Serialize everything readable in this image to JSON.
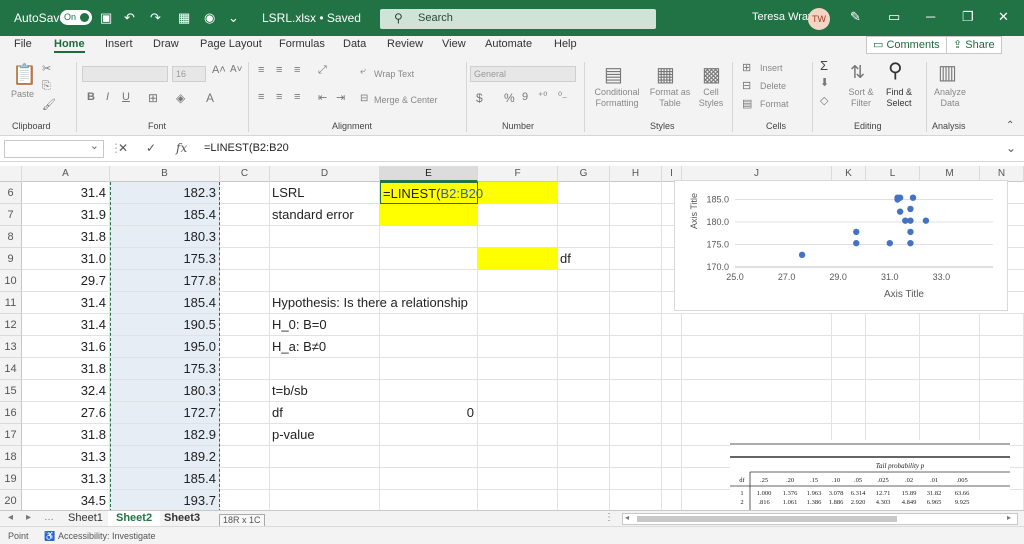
{
  "titlebar": {
    "autosave_label": "AutoSave",
    "autosave_state": "On",
    "filename": "LSRL.xlsx • Saved",
    "search_placeholder": "Search",
    "user_name": "Teresa Wray",
    "user_initials": "TW"
  },
  "menu": {
    "tabs": [
      "File",
      "Home",
      "Insert",
      "Draw",
      "Page Layout",
      "Formulas",
      "Data",
      "Review",
      "View",
      "Automate",
      "Help"
    ],
    "active": "Home",
    "comments": "Comments",
    "share": "Share"
  },
  "ribbon": {
    "paste": "Paste",
    "font_name": "",
    "font_size": "16",
    "wrap_text": "Wrap Text",
    "merge_center": "Merge & Center",
    "number_format": "General",
    "conditional_formatting": "Conditional Formatting",
    "format_as_table": "Format as Table",
    "cell_styles": "Cell Styles",
    "insert": "Insert",
    "delete": "Delete",
    "format": "Format",
    "sort_filter": "Sort & Filter",
    "find_select": "Find & Select",
    "analyze_data": "Analyze Data",
    "groups": [
      "Clipboard",
      "Font",
      "Alignment",
      "Number",
      "Styles",
      "Cells",
      "Editing",
      "Analysis"
    ]
  },
  "formula_bar": {
    "formula": "=LINEST(B2:B20"
  },
  "columns": [
    "A",
    "B",
    "C",
    "D",
    "E",
    "F",
    "G",
    "H",
    "I",
    "J",
    "K",
    "L",
    "M",
    "N"
  ],
  "rows": [
    {
      "n": "6",
      "A": "31.4",
      "B": "182.3",
      "D": "LSRL",
      "E": "=LINEST(B2:B20"
    },
    {
      "n": "7",
      "A": "31.9",
      "B": "185.4",
      "D": "standard error"
    },
    {
      "n": "8",
      "A": "31.8",
      "B": "180.3"
    },
    {
      "n": "9",
      "A": "31.0",
      "B": "175.3",
      "G": "df"
    },
    {
      "n": "10",
      "A": "29.7",
      "B": "177.8"
    },
    {
      "n": "11",
      "A": "31.4",
      "B": "185.4",
      "D": "Hypothesis: Is there a relationship"
    },
    {
      "n": "12",
      "A": "31.4",
      "B": "190.5",
      "D": "H_0: B=0"
    },
    {
      "n": "13",
      "A": "31.6",
      "B": "195.0",
      "D": "H_a: B≠0"
    },
    {
      "n": "14",
      "A": "31.8",
      "B": "175.3"
    },
    {
      "n": "15",
      "A": "32.4",
      "B": "180.3",
      "D": "t=b/sb"
    },
    {
      "n": "16",
      "A": "27.6",
      "B": "172.7",
      "D": "df",
      "E": "0"
    },
    {
      "n": "17",
      "A": "31.8",
      "B": "182.9",
      "D": "p-value"
    },
    {
      "n": "18",
      "A": "31.3",
      "B": "189.2"
    },
    {
      "n": "19",
      "A": "31.3",
      "B": "185.4"
    },
    {
      "n": "20",
      "A": "34.5",
      "B": "193.7"
    }
  ],
  "chart_data": {
    "type": "scatter",
    "xlabel": "Axis Title",
    "ylabel": "Axis Title",
    "xlim": [
      25.0,
      35.0
    ],
    "ylim": [
      170.0,
      186.0
    ],
    "xticks": [
      "25.0",
      "27.0",
      "29.0",
      "31.0",
      "33.0"
    ],
    "yticks": [
      "170.0",
      "175.0",
      "180.0",
      "185.0"
    ],
    "points": [
      {
        "x": 27.6,
        "y": 172.7
      },
      {
        "x": 29.7,
        "y": 177.8
      },
      {
        "x": 29.7,
        "y": 175.3
      },
      {
        "x": 31.0,
        "y": 175.3
      },
      {
        "x": 31.3,
        "y": 185.4
      },
      {
        "x": 31.4,
        "y": 185.4
      },
      {
        "x": 31.4,
        "y": 182.3
      },
      {
        "x": 31.3,
        "y": 185.0
      },
      {
        "x": 31.8,
        "y": 180.3
      },
      {
        "x": 31.8,
        "y": 182.9
      },
      {
        "x": 31.8,
        "y": 177.8
      },
      {
        "x": 31.8,
        "y": 175.3
      },
      {
        "x": 31.9,
        "y": 185.4
      },
      {
        "x": 31.6,
        "y": 180.3
      },
      {
        "x": 32.4,
        "y": 180.3
      }
    ],
    "marker_color": "#4472c4"
  },
  "prob_table": {
    "title": "Tail probability p",
    "headers": [
      "df",
      ".25",
      ".20",
      ".15",
      ".10",
      ".05",
      ".025",
      ".02",
      ".01",
      ".005"
    ],
    "rows": [
      [
        "1",
        "1.000",
        "1.376",
        "1.963",
        "3.078",
        "6.314",
        "12.71",
        "15.89",
        "31.82",
        "63.66"
      ],
      [
        "2",
        ".816",
        "1.061",
        "1.386",
        "1.886",
        "2.920",
        "4.303",
        "4.849",
        "6.965",
        "9.925"
      ]
    ]
  },
  "sheets": {
    "tabs": [
      "Sheet1",
      "Sheet2",
      "Sheet3"
    ],
    "active": "Sheet2",
    "drag_tooltip": "18R x 1C"
  },
  "status": {
    "mode": "Point",
    "accessibility": "Accessibility: Investigate"
  },
  "colors": {
    "excel_green": "#217346",
    "highlight_yellow": "#ffff00"
  }
}
